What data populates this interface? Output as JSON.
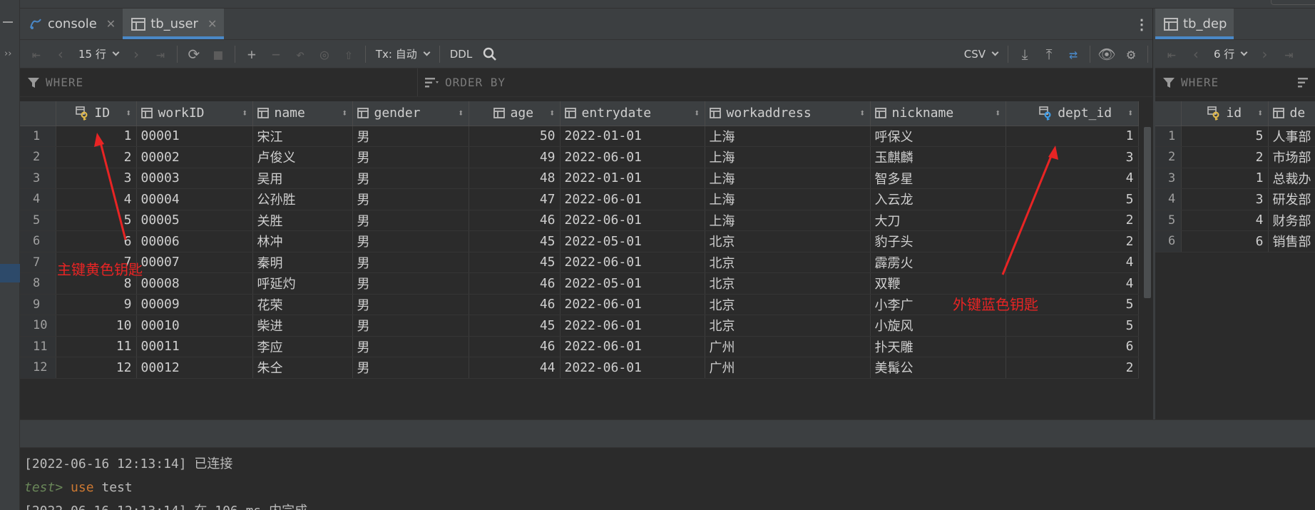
{
  "left_tabs": [
    {
      "label": "console",
      "active": false
    },
    {
      "label": "tb_user",
      "active": true
    }
  ],
  "right_tabs": [
    {
      "label": "tb_dep",
      "active": true
    }
  ],
  "left_toolbar": {
    "rows": "15 行",
    "tx": "Tx: 自动",
    "ddl": "DDL",
    "format": "CSV"
  },
  "right_toolbar": {
    "rows": "6 行"
  },
  "left_filter": {
    "where": "WHERE",
    "order_by": "ORDER BY"
  },
  "right_filter": {
    "where": "WHERE"
  },
  "tb_user": {
    "columns": [
      "ID",
      "workID",
      "name",
      "gender",
      "age",
      "entrydate",
      "workaddress",
      "nickname",
      "dept_id"
    ],
    "rows": [
      [
        "1",
        "1",
        "00001",
        "宋江",
        "男",
        "50",
        "2022-01-01",
        "上海",
        "呼保义",
        "1"
      ],
      [
        "2",
        "2",
        "00002",
        "卢俊义",
        "男",
        "49",
        "2022-06-01",
        "上海",
        "玉麒麟",
        "3"
      ],
      [
        "3",
        "3",
        "00003",
        "吴用",
        "男",
        "48",
        "2022-01-01",
        "上海",
        "智多星",
        "4"
      ],
      [
        "4",
        "4",
        "00004",
        "公孙胜",
        "男",
        "47",
        "2022-06-01",
        "上海",
        "入云龙",
        "5"
      ],
      [
        "5",
        "5",
        "00005",
        "关胜",
        "男",
        "46",
        "2022-06-01",
        "上海",
        "大刀",
        "2"
      ],
      [
        "6",
        "6",
        "00006",
        "林冲",
        "男",
        "45",
        "2022-05-01",
        "北京",
        "豹子头",
        "2"
      ],
      [
        "7",
        "7",
        "00007",
        "秦明",
        "男",
        "45",
        "2022-06-01",
        "北京",
        "霹雳火",
        "4"
      ],
      [
        "8",
        "8",
        "00008",
        "呼延灼",
        "男",
        "46",
        "2022-05-01",
        "北京",
        "双鞭",
        "4"
      ],
      [
        "9",
        "9",
        "00009",
        "花荣",
        "男",
        "46",
        "2022-06-01",
        "北京",
        "小李广",
        "5"
      ],
      [
        "10",
        "10",
        "00010",
        "柴进",
        "男",
        "45",
        "2022-06-01",
        "北京",
        "小旋风",
        "5"
      ],
      [
        "11",
        "11",
        "00011",
        "李应",
        "男",
        "46",
        "2022-06-01",
        "广州",
        "扑天雕",
        "6"
      ],
      [
        "12",
        "12",
        "00012",
        "朱仝",
        "男",
        "44",
        "2022-06-01",
        "广州",
        "美髯公",
        "2"
      ]
    ]
  },
  "tb_dep": {
    "columns": [
      "id",
      "de"
    ],
    "rows": [
      [
        "1",
        "5",
        "人事部"
      ],
      [
        "2",
        "2",
        "市场部"
      ],
      [
        "3",
        "1",
        "总裁办"
      ],
      [
        "4",
        "3",
        "研发部"
      ],
      [
        "5",
        "4",
        "财务部"
      ],
      [
        "6",
        "6",
        "销售部"
      ]
    ]
  },
  "annotations": {
    "primary_key": "主键黄色钥匙",
    "foreign_key": "外键蓝色钥匙"
  },
  "console_lines": [
    {
      "text": "[2022-06-16 12:13:14] 已连接"
    },
    {
      "prompt": "test>",
      "kw": "use",
      "rest": " test"
    },
    {
      "text": "[2022-06-16 12:13:14] 在 106 ms 内完成"
    }
  ],
  "colors": {
    "accent": "#4a88c7",
    "pk_key": "#e0b84a",
    "fk_key": "#3d9be6",
    "annotation": "#e82424"
  }
}
